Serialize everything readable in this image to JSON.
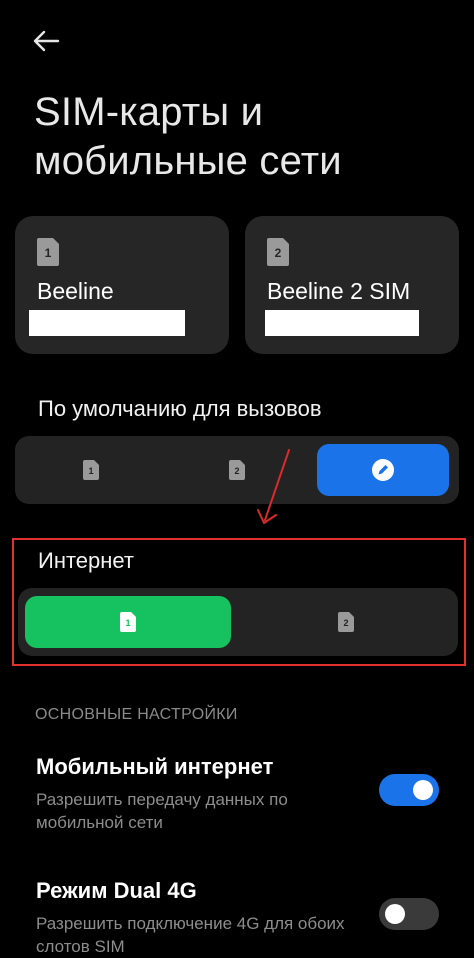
{
  "header": {
    "title_line1": "SIM-карты и",
    "title_line2": "мобильные сети"
  },
  "sims": [
    {
      "slot": "1",
      "name": "Beeline"
    },
    {
      "slot": "2",
      "name": "Beeline 2 SIM"
    }
  ],
  "calls": {
    "label": "По умолчанию для вызовов",
    "options": [
      "1",
      "2",
      "edit"
    ],
    "selected": "edit"
  },
  "internet": {
    "label": "Интернет",
    "options": [
      "1",
      "2"
    ],
    "selected": "1"
  },
  "section_title": "ОСНОВНЫЕ НАСТРОЙКИ",
  "mobile_data": {
    "title": "Мобильный интернет",
    "subtitle": "Разрешить передачу данных по мобильной сети",
    "enabled": true
  },
  "dual4g": {
    "title": "Режим Dual 4G",
    "subtitle": "Разрешить подключение 4G для обоих слотов SIM",
    "enabled": false
  },
  "colors": {
    "accent_blue": "#1a73e8",
    "accent_green": "#16c25f",
    "highlight_red": "#e23030"
  },
  "icons": {
    "back": "back-arrow-icon",
    "sim": "sim-card-icon",
    "edit": "pencil-icon",
    "annotation": "red-arrow-icon"
  }
}
